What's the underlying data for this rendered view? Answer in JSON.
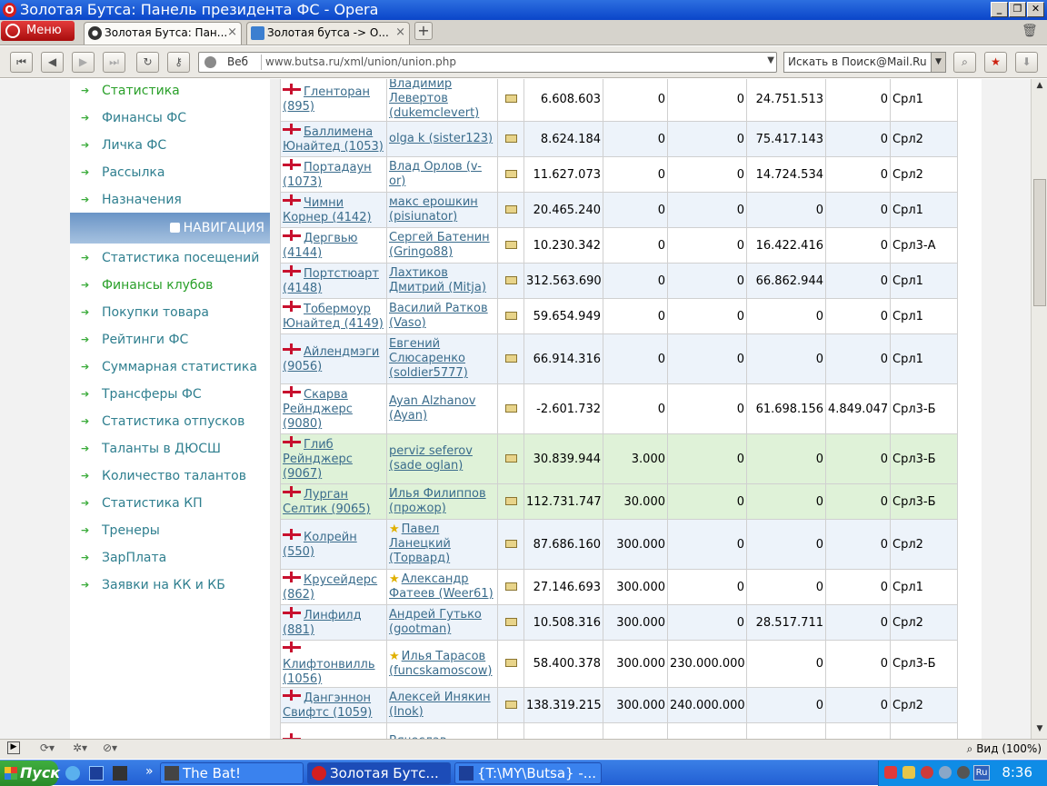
{
  "window": {
    "title": "Золотая Бутса: Панель президента ФС - Opera"
  },
  "tabs": {
    "menu_label": "Меню",
    "items": [
      {
        "label": "Золотая Бутса: Пан...",
        "active": true
      },
      {
        "label": "Золотая бутса -> О...",
        "active": false
      }
    ]
  },
  "addressbar": {
    "scheme_label": "Веб",
    "url": "www.butsa.ru/xml/union/union.php",
    "search_placeholder": "Искать в Поиск@Mail.Ru"
  },
  "sidebar": {
    "items_top": [
      {
        "label": "Статистика",
        "green": true
      },
      {
        "label": "Финансы ФС",
        "green": false
      },
      {
        "label": "Личка ФС",
        "green": false
      },
      {
        "label": "Рассылка",
        "green": false
      },
      {
        "label": "Назначения",
        "green": false
      }
    ],
    "nav_header": "НАВИГАЦИЯ",
    "items_nav": [
      {
        "label": "Статистика посещений",
        "green": false
      },
      {
        "label": "Финансы клубов",
        "green": true
      },
      {
        "label": "Покупки товара",
        "green": false
      },
      {
        "label": "Рейтинги ФС",
        "green": false
      },
      {
        "label": "Суммарная статистика",
        "green": false
      },
      {
        "label": "Трансферы ФС",
        "green": false
      },
      {
        "label": "Статистика отпусков",
        "green": false
      },
      {
        "label": "Таланты в ДЮСШ",
        "green": false
      },
      {
        "label": "Количество талантов",
        "green": false
      },
      {
        "label": "Статистика КП",
        "green": false
      },
      {
        "label": "Тренеры",
        "green": false
      },
      {
        "label": "ЗарПлата",
        "green": false
      },
      {
        "label": "Заявки на КК и КБ",
        "green": false
      }
    ]
  },
  "table": {
    "rows": [
      {
        "club": "Гленторан (895)",
        "manager": "Владимир Левертов (dukemclevert)",
        "star": false,
        "v1": "6.608.603",
        "v2": "0",
        "v3": "0",
        "v4": "24.751.513",
        "v5": "0",
        "league": "Срл1",
        "style": "white"
      },
      {
        "club": "Баллимена Юнайтед (1053)",
        "manager": "olga k (sister123)",
        "star": false,
        "v1": "8.624.184",
        "v2": "0",
        "v3": "0",
        "v4": "75.417.143",
        "v5": "0",
        "league": "Срл2",
        "style": "alt"
      },
      {
        "club": "Портадаун (1073)",
        "manager": "Влад Орлов (v-or)",
        "star": false,
        "v1": "11.627.073",
        "v2": "0",
        "v3": "0",
        "v4": "14.724.534",
        "v5": "0",
        "league": "Срл2",
        "style": "white"
      },
      {
        "club": "Чимни Корнер (4142)",
        "manager": "макс ерошкин (pisiunator)",
        "star": false,
        "v1": "20.465.240",
        "v2": "0",
        "v3": "0",
        "v4": "0",
        "v5": "0",
        "league": "Срл1",
        "style": "alt"
      },
      {
        "club": "Дергвью (4144)",
        "manager": "Сергей Батенин (Gringo88)",
        "star": false,
        "v1": "10.230.342",
        "v2": "0",
        "v3": "0",
        "v4": "16.422.416",
        "v5": "0",
        "league": "Срл3-А",
        "style": "white"
      },
      {
        "club": "Портстюарт (4148)",
        "manager": "Лахтиков Дмитрий (Mitja)",
        "star": false,
        "v1": "312.563.690",
        "v2": "0",
        "v3": "0",
        "v4": "66.862.944",
        "v5": "0",
        "league": "Срл1",
        "style": "alt"
      },
      {
        "club": "Тобермоур Юнайтед (4149)",
        "manager": "Василий Ратков (Vaso)",
        "star": false,
        "v1": "59.654.949",
        "v2": "0",
        "v3": "0",
        "v4": "0",
        "v5": "0",
        "league": "Срл1",
        "style": "white"
      },
      {
        "club": "Айлендмэги (9056)",
        "manager": "Евгений Слюсаренко (soldier5777)",
        "star": false,
        "v1": "66.914.316",
        "v2": "0",
        "v3": "0",
        "v4": "0",
        "v5": "0",
        "league": "Срл1",
        "style": "alt"
      },
      {
        "club": "Скарва Рейнджерс (9080)",
        "manager": "Ayan Alzhanov (Ayan)",
        "star": false,
        "v1": "-2.601.732",
        "v2": "0",
        "v3": "0",
        "v4": "61.698.156",
        "v5": "4.849.047",
        "league": "Срл3-Б",
        "style": "white"
      },
      {
        "club": "Глиб Рейнджерс (9067)",
        "manager": "perviz seferov (sade oglan)",
        "star": false,
        "v1": "30.839.944",
        "v2": "3.000",
        "v3": "0",
        "v4": "0",
        "v5": "0",
        "league": "Срл3-Б",
        "style": "grn"
      },
      {
        "club": "Лурган Селтик (9065)",
        "manager": "Илья Филиппов (прожор)",
        "star": false,
        "v1": "112.731.747",
        "v2": "30.000",
        "v3": "0",
        "v4": "0",
        "v5": "0",
        "league": "Срл3-Б",
        "style": "grn"
      },
      {
        "club": "Колрейн (550)",
        "manager": "Павел Ланецкий (Торвард)",
        "star": true,
        "v1": "87.686.160",
        "v2": "300.000",
        "v3": "0",
        "v4": "0",
        "v5": "0",
        "league": "Срл2",
        "style": "alt"
      },
      {
        "club": "Крусейдерс (862)",
        "manager": "Александр Фатеев (Weer61)",
        "star": true,
        "v1": "27.146.693",
        "v2": "300.000",
        "v3": "0",
        "v4": "0",
        "v5": "0",
        "league": "Срл1",
        "style": "white"
      },
      {
        "club": "Линфилд (881)",
        "manager": "Андрей Гутько (gootman)",
        "star": false,
        "v1": "10.508.316",
        "v2": "300.000",
        "v3": "0",
        "v4": "28.517.711",
        "v5": "0",
        "league": "Срл2",
        "style": "alt"
      },
      {
        "club": "Клифтонвилль (1056)",
        "manager": "Илья Тарасов (funcskamoscow)",
        "star": true,
        "v1": "58.400.378",
        "v2": "300.000",
        "v3": "230.000.000",
        "v4": "0",
        "v5": "0",
        "league": "Срл3-Б",
        "style": "white"
      },
      {
        "club": "Дангэннон Свифтс (1059)",
        "manager": "Алексей Инякин (Inok)",
        "star": false,
        "v1": "138.319.215",
        "v2": "300.000",
        "v3": "240.000.000",
        "v4": "0",
        "v5": "0",
        "league": "Срл2",
        "style": "alt"
      },
      {
        "club": "",
        "manager": "Вячеслав",
        "star": false,
        "v1": "",
        "v2": "",
        "v3": "",
        "v4": "",
        "v5": "",
        "league": "",
        "style": "white"
      }
    ]
  },
  "statusbar": {
    "zoom_label": "Вид (100%)"
  },
  "taskbar": {
    "start_label": "Пуск",
    "tasks": [
      {
        "label": "The Bat!",
        "active": false
      },
      {
        "label": "Золотая Бутс...",
        "active": true
      },
      {
        "label": "{T:\\MY\\Butsa} -...",
        "active": false
      }
    ],
    "tray_lang": "Ru",
    "clock": "8:36"
  }
}
